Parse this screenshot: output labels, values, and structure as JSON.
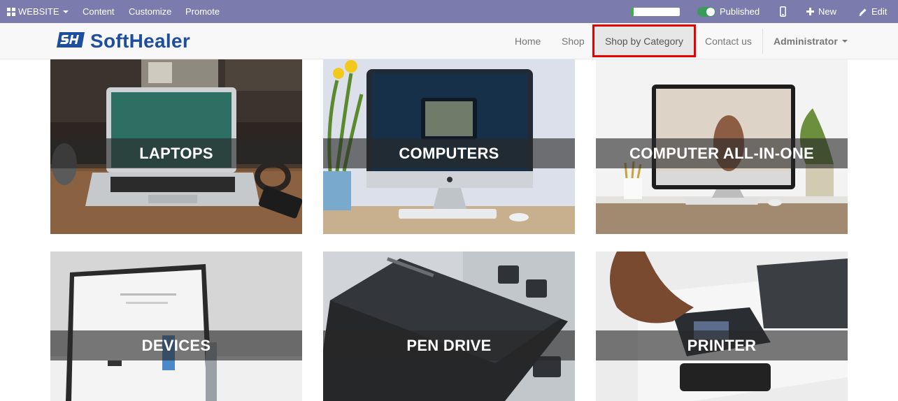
{
  "adminbar": {
    "website_label": "WEBSITE",
    "content_label": "Content",
    "customize_label": "Customize",
    "promote_label": "Promote",
    "published_label": "Published",
    "new_label": "New",
    "edit_label": "Edit"
  },
  "navbar": {
    "brand": "SoftHealer",
    "links": [
      "Home",
      "Shop",
      "Shop by Category",
      "Contact us"
    ],
    "user": "Administrator"
  },
  "categories": [
    {
      "name": "LAPTOPS"
    },
    {
      "name": "COMPUTERS"
    },
    {
      "name": "COMPUTER ALL-IN-ONE"
    },
    {
      "name": "DEVICES"
    },
    {
      "name": "PEN DRIVE"
    },
    {
      "name": "PRINTER"
    }
  ],
  "colors": {
    "adminbar_bg": "#7c7bad",
    "brand_blue": "#1d4f9e",
    "active_outline": "#e60000"
  },
  "icons": {
    "website": "grid-icon",
    "new": "plus-icon",
    "edit": "pencil-icon",
    "mobile": "mobile-icon"
  }
}
